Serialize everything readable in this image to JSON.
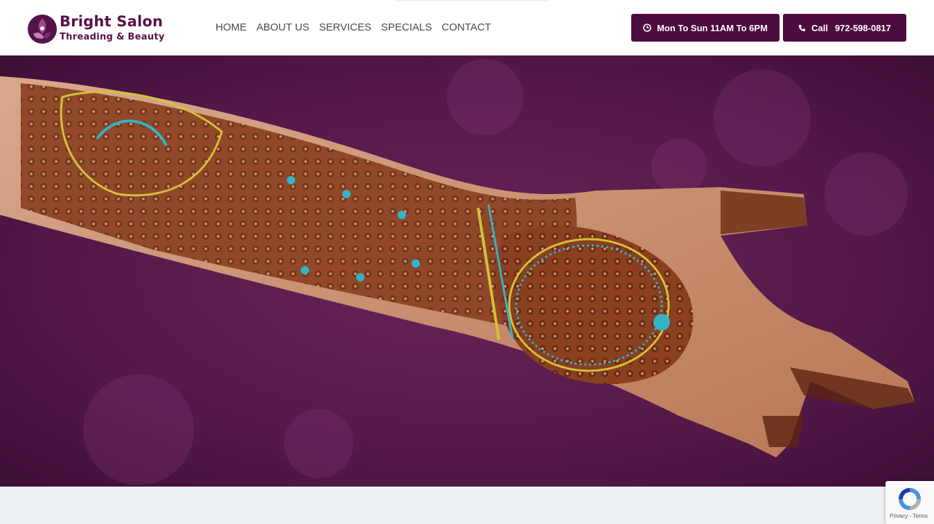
{
  "brand": {
    "title": "Bright Salon",
    "subtitle": "Threading & Beauty",
    "color": "#56124a"
  },
  "nav": {
    "items": [
      {
        "label": "HOME"
      },
      {
        "label": "ABOUT US"
      },
      {
        "label": "SERVICES"
      },
      {
        "label": "SPECIALS"
      },
      {
        "label": "CONTACT"
      }
    ]
  },
  "header_buttons": {
    "hours": {
      "label": "Mon To Sun 11AM To 6PM",
      "icon": "clock-icon"
    },
    "call": {
      "label": "Call",
      "phone": "972-598-0817",
      "icon": "phone-icon"
    },
    "color": "#4d0b40"
  },
  "hero": {
    "image": "henna-hand-photo",
    "slides": 3,
    "active_slide": 3
  },
  "recaptcha": {
    "links": "Privacy - Terms"
  }
}
